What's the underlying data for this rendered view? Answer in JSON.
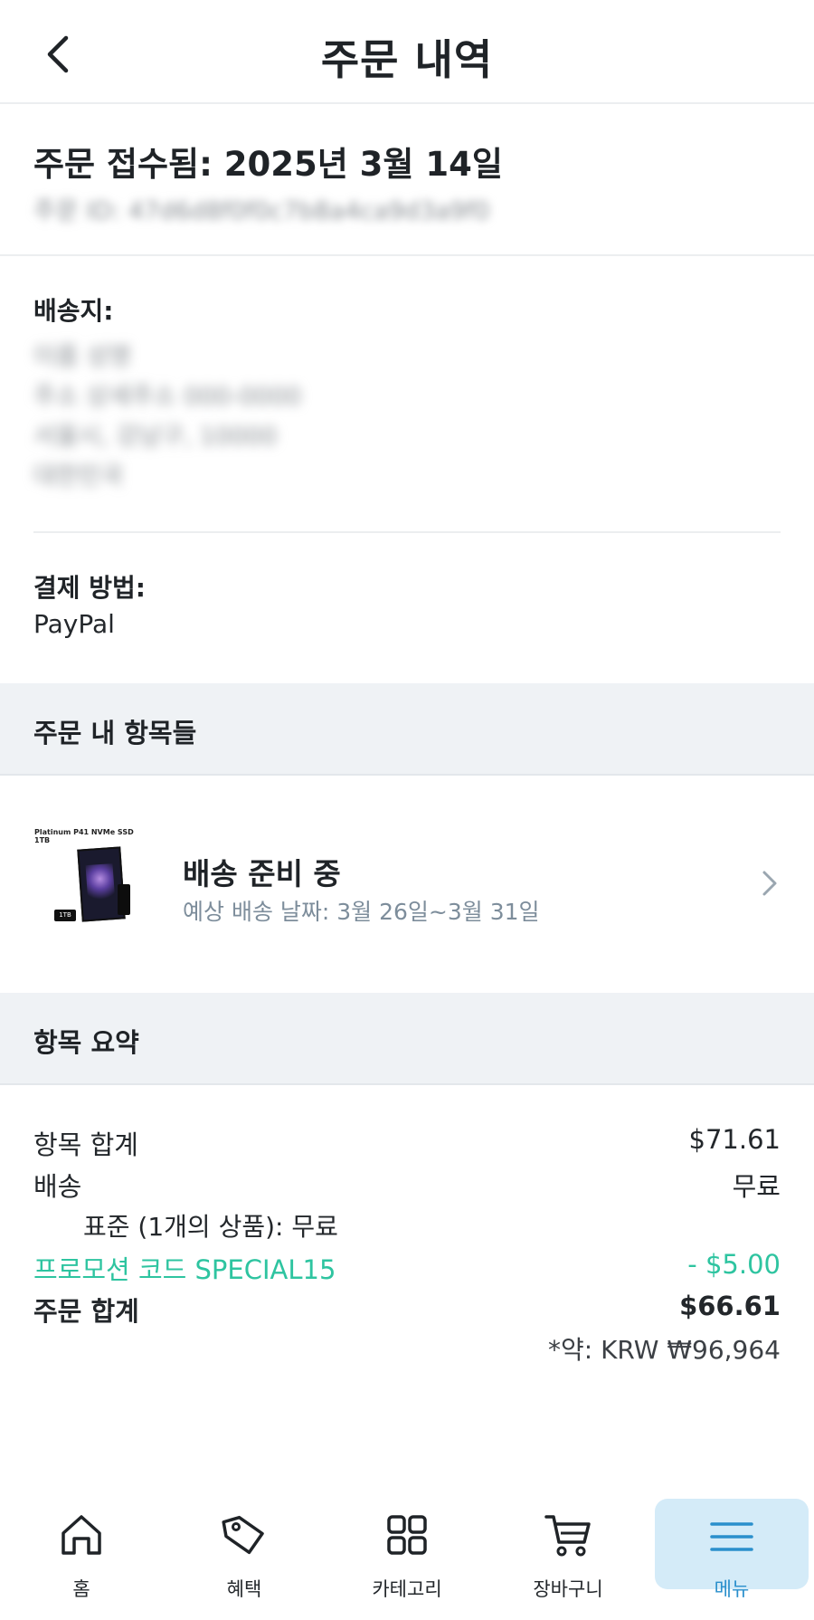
{
  "header": {
    "title": "주문 내역",
    "back_icon": "chevron-left-icon"
  },
  "order": {
    "title": "주문 접수됨: 2025년 3월 14일",
    "id_line": "주문 ID: 47d6d8f0f0c7b8a4ca9d3a9f0"
  },
  "shipping": {
    "label": "배송지:",
    "lines": [
      "이름 성명",
      "주소 상세주소 000-0000",
      "서울시, 강남구, 10000",
      "대한민국"
    ]
  },
  "payment": {
    "label": "결제 방법:",
    "value": "PayPal"
  },
  "items_section": {
    "title": "주문 내 항목들",
    "items": [
      {
        "thumb_title": "Platinum P41 NVMe SSD 1TB",
        "thumb_tag": "1TB",
        "status": "배송 준비 중",
        "eta": "예상 배송 날짜: 3월 26일~3월 31일"
      }
    ]
  },
  "summary_section": {
    "title": "항목 요약",
    "subtotal_label": "항목 합계",
    "subtotal_value": "$71.61",
    "shipping_label": "배송",
    "shipping_value": "무료",
    "shipping_detail": "표준 (1개의 상품):  무료",
    "promo_label": "프로모션 코드 SPECIAL15",
    "promo_value": "- $5.00",
    "total_label": "주문 합계",
    "total_value": "$66.61",
    "approx": "*약: KRW ₩96,964"
  },
  "tabbar": {
    "tabs": [
      {
        "label": "홈",
        "icon": "home-icon"
      },
      {
        "label": "혜택",
        "icon": "tag-icon"
      },
      {
        "label": "카테고리",
        "icon": "grid-icon"
      },
      {
        "label": "장바구니",
        "icon": "cart-icon"
      },
      {
        "label": "메뉴",
        "icon": "menu-icon"
      }
    ],
    "active_index": 4
  },
  "colors": {
    "accent": "#2a8fcc",
    "promo": "#2ec4a0",
    "band": "#eff2f5",
    "muted": "#7d8d9b"
  }
}
